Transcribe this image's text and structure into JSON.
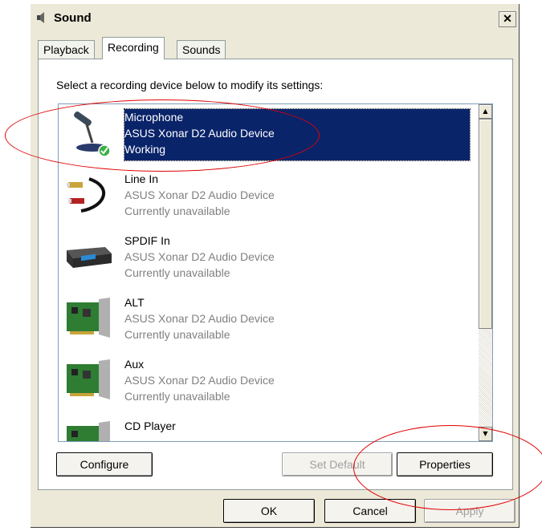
{
  "window": {
    "title": "Sound",
    "close_label": "✕"
  },
  "tabs": [
    {
      "label": "Playback"
    },
    {
      "label": "Recording"
    },
    {
      "label": "Sounds"
    }
  ],
  "instructions": "Select a recording device below to modify its settings:",
  "devices": [
    {
      "name": "Microphone",
      "driver": "ASUS Xonar D2 Audio Device",
      "status": "Working",
      "icon": "microphone-icon",
      "selected": true
    },
    {
      "name": "Line In",
      "driver": "ASUS Xonar D2 Audio Device",
      "status": "Currently unavailable",
      "icon": "rca-cable-icon"
    },
    {
      "name": "SPDIF In",
      "driver": "ASUS Xonar D2 Audio Device",
      "status": "Currently unavailable",
      "icon": "audio-receiver-icon"
    },
    {
      "name": "ALT",
      "driver": "ASUS Xonar D2 Audio Device",
      "status": "Currently unavailable",
      "icon": "sound-card-icon"
    },
    {
      "name": "Aux",
      "driver": "ASUS Xonar D2 Audio Device",
      "status": "Currently unavailable",
      "icon": "sound-card-icon"
    },
    {
      "name": "CD Player",
      "driver": "",
      "status": "",
      "icon": "sound-card-icon"
    }
  ],
  "panel_buttons": {
    "configure": "Configure",
    "set_default": "Set Default",
    "properties": "Properties"
  },
  "dialog_buttons": {
    "ok": "OK",
    "cancel": "Cancel",
    "apply": "Apply"
  },
  "colors": {
    "selection": "#0a246a",
    "annotation": "#e00000"
  }
}
